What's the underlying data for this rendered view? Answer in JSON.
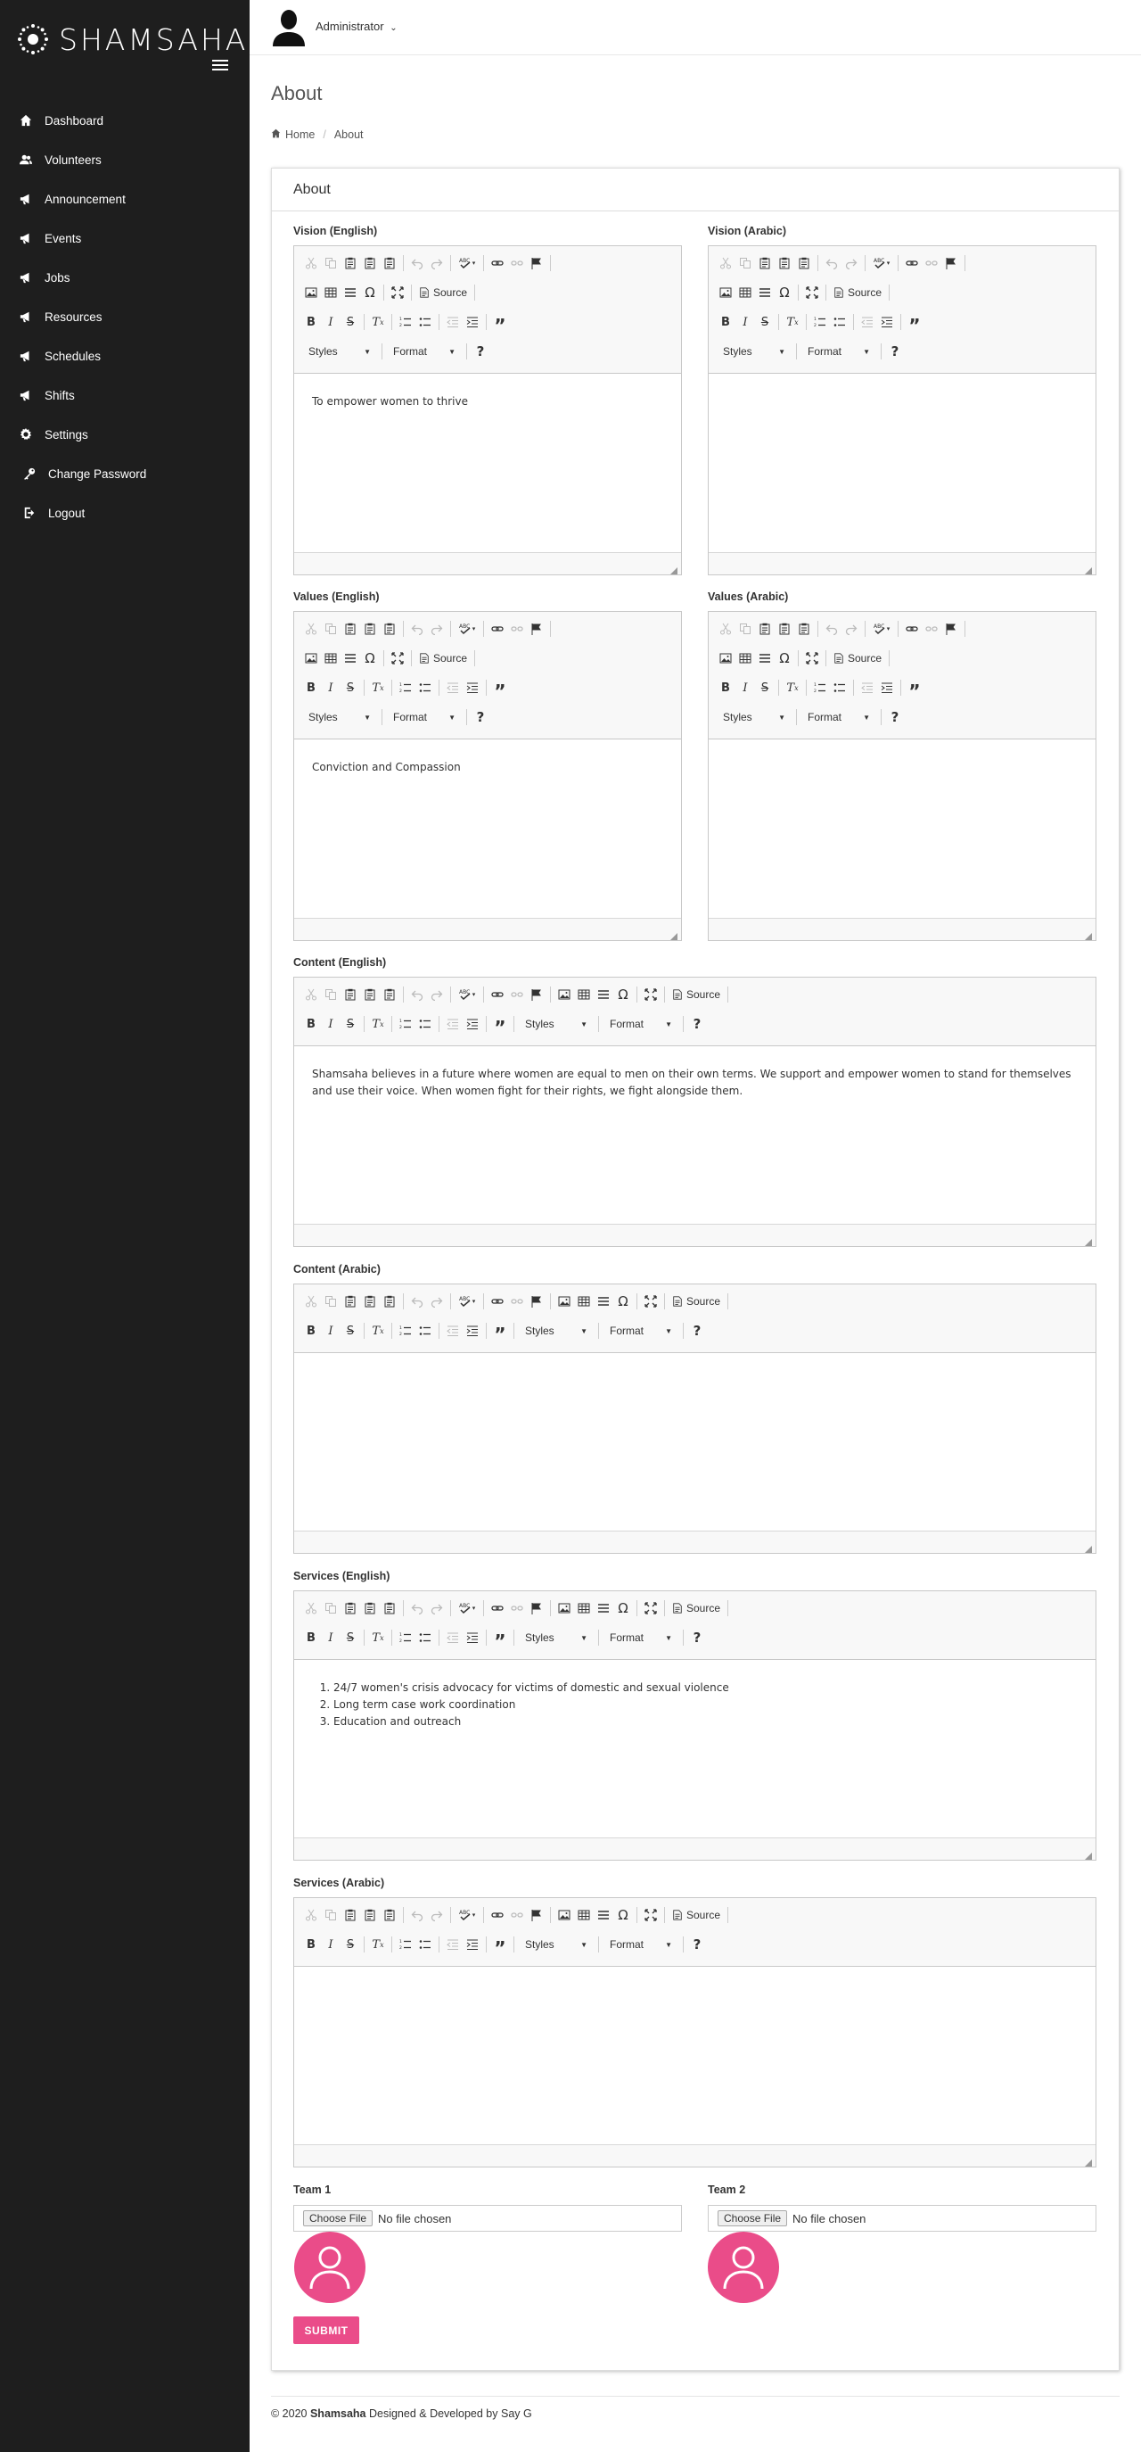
{
  "brand": {
    "name": "SHAMSAHA"
  },
  "nav": [
    {
      "label": "Dashboard",
      "icon": "home-icon"
    },
    {
      "label": "Volunteers",
      "icon": "users-icon"
    },
    {
      "label": "Announcement",
      "icon": "megaphone-icon"
    },
    {
      "label": "Events",
      "icon": "megaphone-icon"
    },
    {
      "label": "Jobs",
      "icon": "megaphone-icon"
    },
    {
      "label": "Resources",
      "icon": "megaphone-icon"
    },
    {
      "label": "Schedules",
      "icon": "megaphone-icon"
    },
    {
      "label": "Shifts",
      "icon": "megaphone-icon"
    },
    {
      "label": "Settings",
      "icon": "gear-icon"
    },
    {
      "label": "Change Password",
      "icon": "key-icon"
    },
    {
      "label": "Logout",
      "icon": "logout-icon"
    }
  ],
  "topbar": {
    "user": "Administrator"
  },
  "page": {
    "title": "About"
  },
  "breadcrumb": {
    "home": "Home",
    "current": "About"
  },
  "panel": {
    "title": "About"
  },
  "toolbar": {
    "source": "Source",
    "styles": "Styles",
    "format": "Format",
    "help": "?"
  },
  "fields": {
    "vision_en": {
      "label": "Vision (English)",
      "content": "To empower women to thrive"
    },
    "vision_ar": {
      "label": "Vision (Arabic)",
      "content": ""
    },
    "values_en": {
      "label": "Values (English)",
      "content": "Conviction and Compassion"
    },
    "values_ar": {
      "label": "Values (Arabic)",
      "content": ""
    },
    "content_en": {
      "label": "Content (English)",
      "content": "Shamsaha believes in a future where women are equal to men on their own terms. We support and empower women to stand for themselves and use their voice. When women fight for their rights, we fight alongside them."
    },
    "content_ar": {
      "label": "Content (Arabic)",
      "content": ""
    },
    "services_en": {
      "label": "Services (English)",
      "items": [
        "24/7 women's crisis advocacy for victims of domestic and sexual violence",
        "Long term case work coordination",
        "Education and outreach"
      ]
    },
    "services_ar": {
      "label": "Services (Arabic)",
      "content": ""
    }
  },
  "team": [
    {
      "label": "Team 1",
      "button": "Choose File",
      "status": "No file chosen"
    },
    {
      "label": "Team 2",
      "button": "Choose File",
      "status": "No file chosen"
    }
  ],
  "submit": "SUBMIT",
  "footer": {
    "prefix": "© 2020 ",
    "brand": "Shamsaha",
    "middle": " Designed & Developed by ",
    "dev": "Say G"
  },
  "colors": {
    "sidebar": "#1e1e1e",
    "accent": "#ea4c89"
  }
}
